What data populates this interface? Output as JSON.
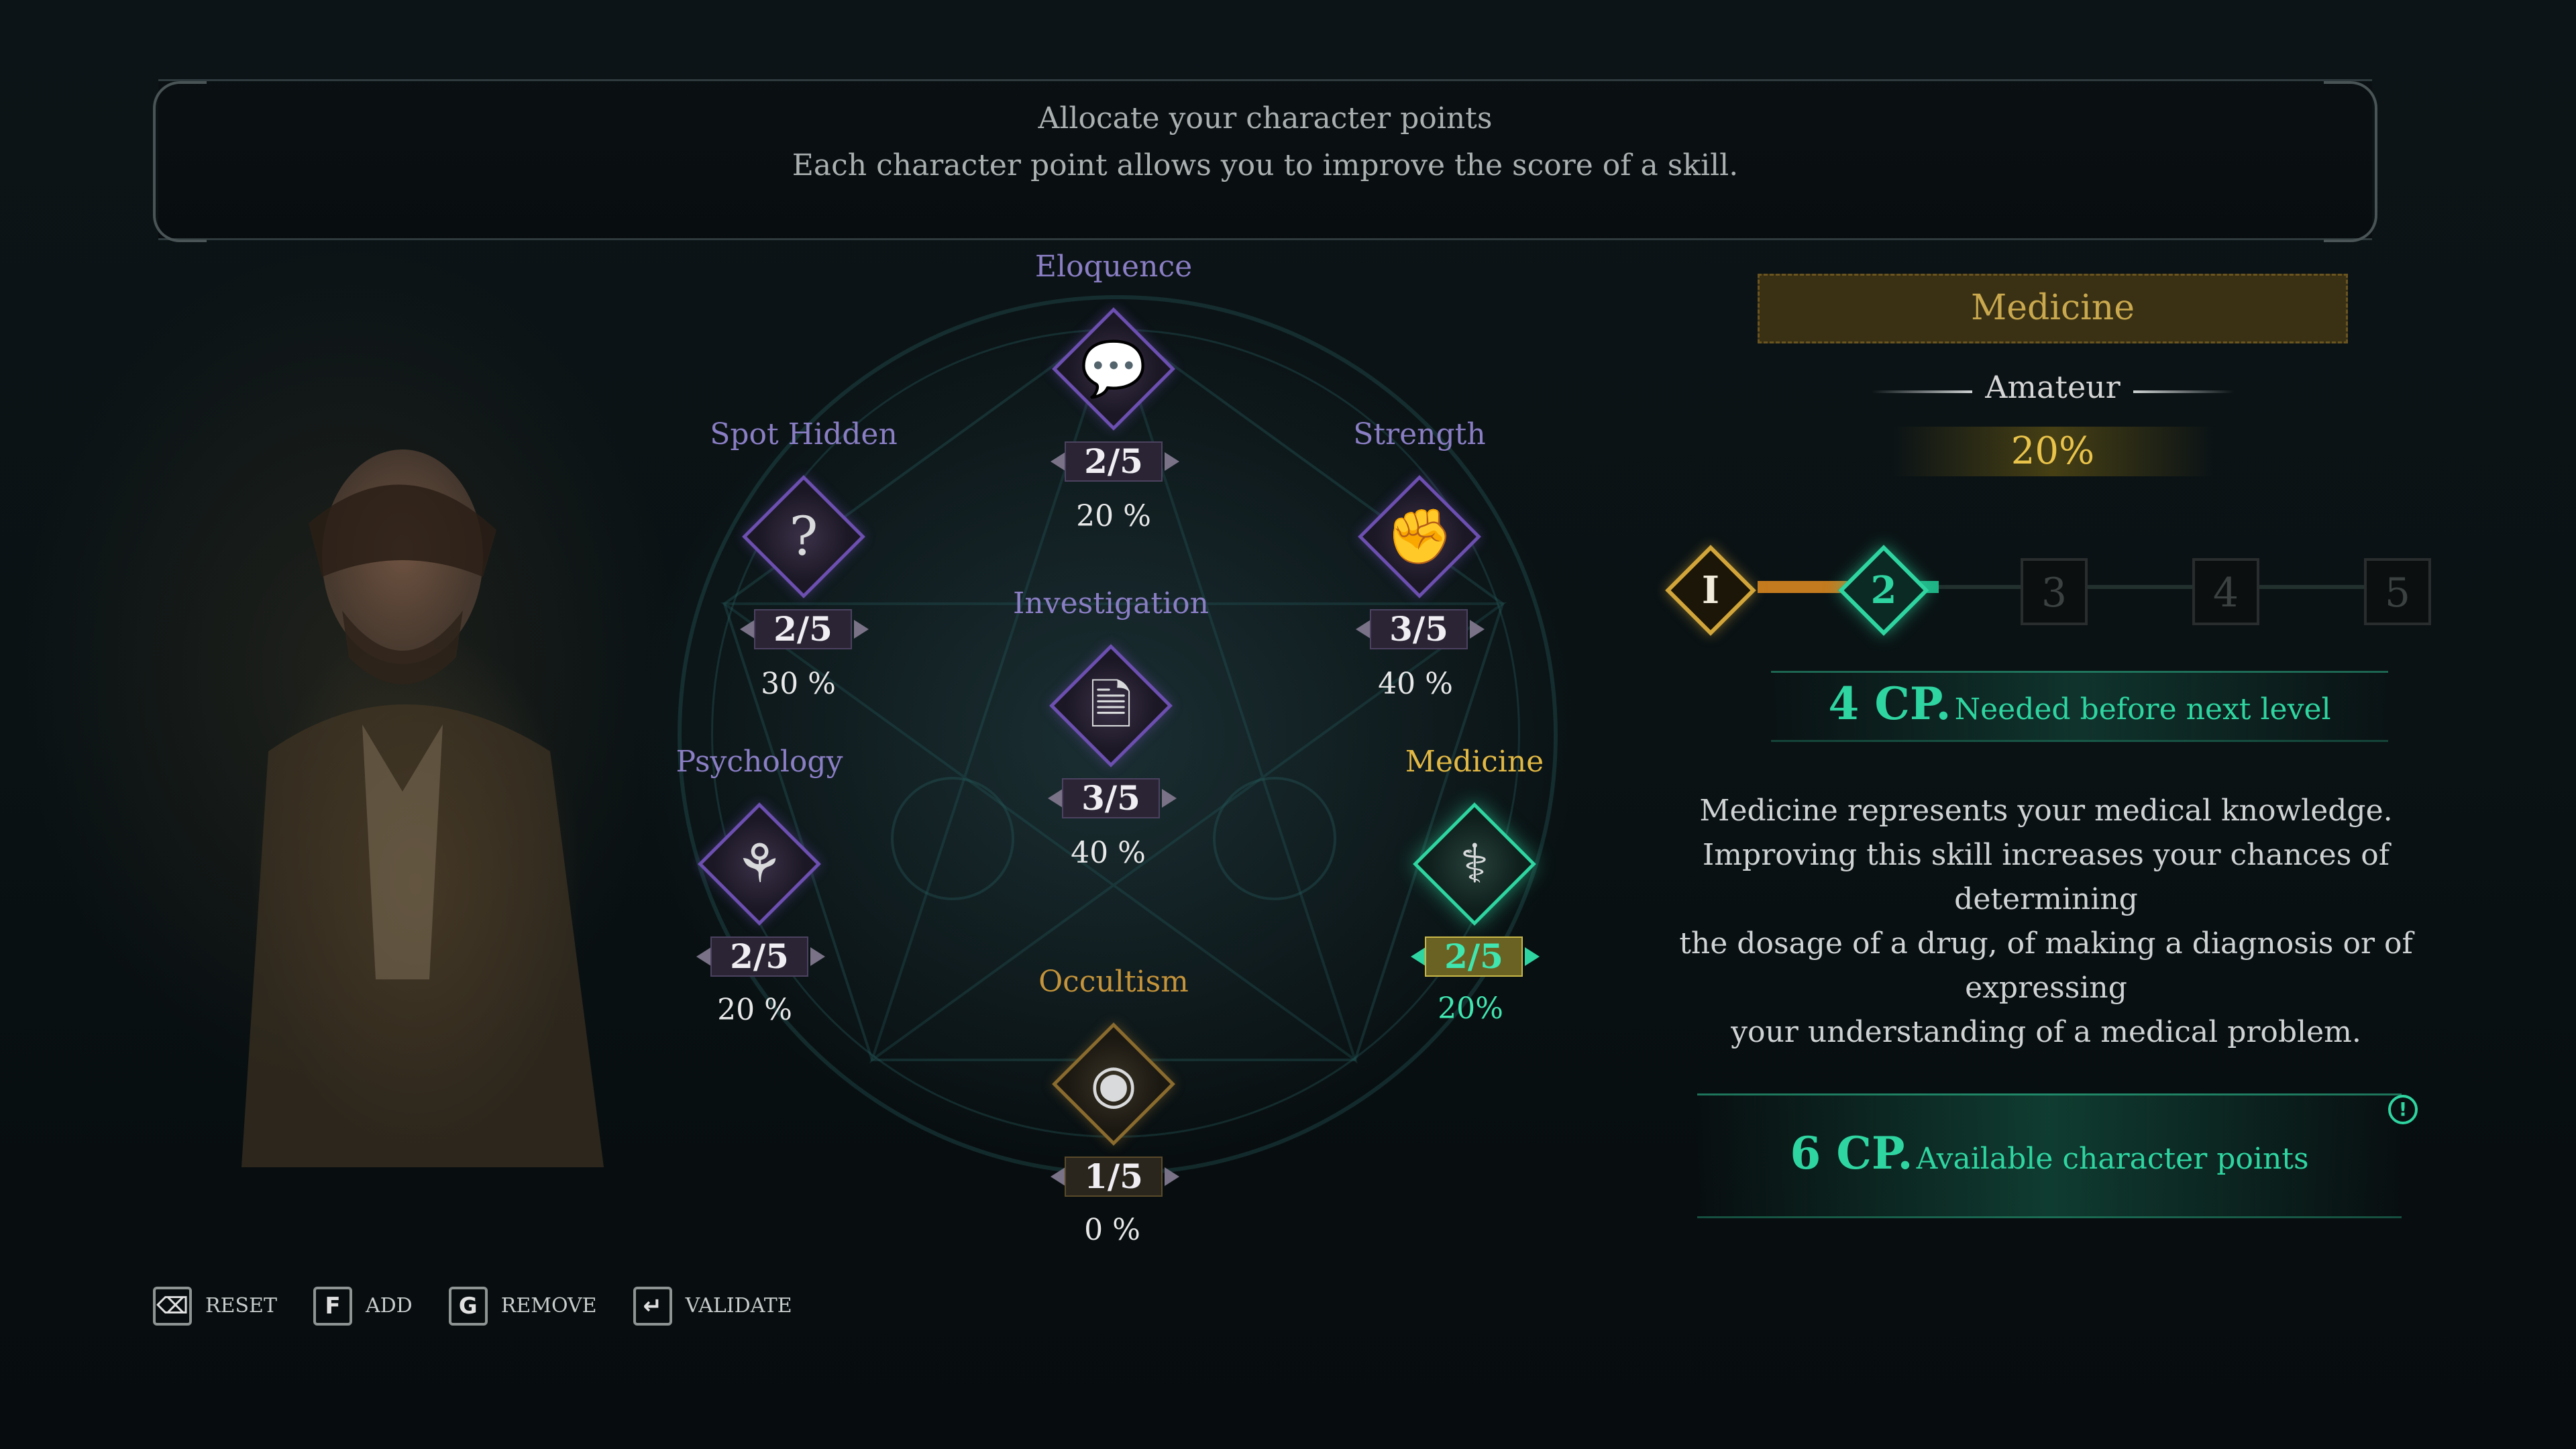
{
  "banner": {
    "line1": "Allocate your character points",
    "line2": "Each character point allows you to improve the score of a skill."
  },
  "skills": [
    {
      "name": "Eloquence",
      "icon": "speech-bubbles-icon",
      "glyph": "💬",
      "score": "2/5",
      "chance": "20 %"
    },
    {
      "name": "Spot Hidden",
      "icon": "question-mark-icon",
      "glyph": "?",
      "score": "2/5",
      "chance": "30 %"
    },
    {
      "name": "Strength",
      "icon": "fist-icon",
      "glyph": "✊",
      "score": "3/5",
      "chance": "40 %"
    },
    {
      "name": "Investigation",
      "icon": "documents-icon",
      "glyph": "🗎",
      "score": "3/5",
      "chance": "40 %"
    },
    {
      "name": "Psychology",
      "icon": "brain-icon",
      "glyph": "⚘",
      "score": "2/5",
      "chance": "20 %"
    },
    {
      "name": "Medicine",
      "icon": "caduceus-icon",
      "glyph": "⚕",
      "score": "2/5",
      "chance": "20%"
    },
    {
      "name": "Occultism",
      "icon": "eye-sigil-icon",
      "glyph": "◉",
      "score": "1/5",
      "chance": "0 %"
    }
  ],
  "detail": {
    "title": "Medicine",
    "rank": "Amateur",
    "rank_percent": "20%",
    "levels": [
      "I",
      "2",
      "3",
      "4",
      "5"
    ],
    "current_level": 2,
    "cp_needed_value": "4 CP.",
    "cp_needed_text": "Needed before next level",
    "description": [
      "Medicine represents your medical knowledge.",
      "Improving this skill increases your chances of determining",
      "the dosage of a drug, of making a diagnosis or of expressing",
      "your understanding of a medical problem."
    ],
    "cp_available_value": "6 CP.",
    "cp_available_text": "Available character points",
    "info_glyph": "!"
  },
  "controls": [
    {
      "key": "⌫",
      "label": "RESET",
      "icon": "backspace-icon"
    },
    {
      "key": "F",
      "label": "ADD",
      "icon": "key-f-icon"
    },
    {
      "key": "G",
      "label": "REMOVE",
      "icon": "key-g-icon"
    },
    {
      "key": "↵",
      "label": "VALIDATE",
      "icon": "enter-icon"
    }
  ],
  "colors": {
    "accent_green": "#2fd5a0",
    "gold": "#c9a84e",
    "purple": "#8a7ec4"
  }
}
